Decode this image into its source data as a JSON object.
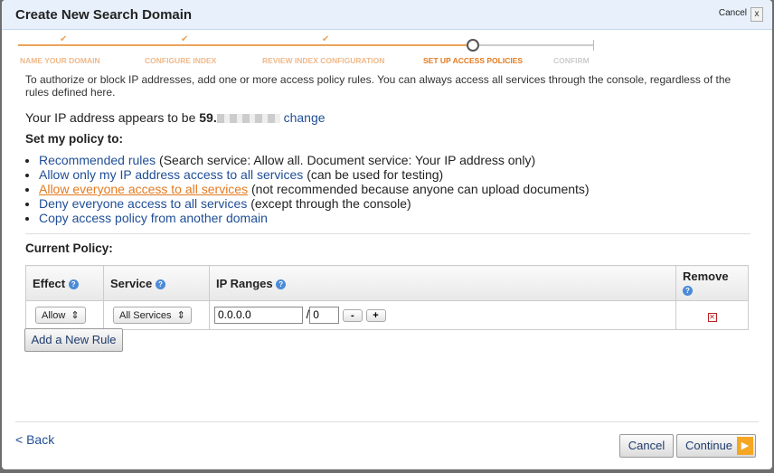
{
  "title": "Create New Search Domain",
  "cancel_top": "Cancel",
  "close": "x",
  "steps": [
    {
      "label": "NAME YOUR DOMAIN",
      "state": "done"
    },
    {
      "label": "CONFIGURE INDEX",
      "state": "done"
    },
    {
      "label": "REVIEW INDEX CONFIGURATION",
      "state": "done"
    },
    {
      "label": "SET UP ACCESS POLICIES",
      "state": "current"
    },
    {
      "label": "CONFIRM",
      "state": "pending"
    }
  ],
  "intro": "To authorize or block IP addresses, add one or more access policy rules. You can always access all services through the console, regardless of the rules defined here.",
  "ip_prefix": "Your IP address appears to be ",
  "ip_value": "59.",
  "ip_change": "change",
  "set_policy": "Set my policy to:",
  "options": [
    {
      "link": "Recommended rules",
      "rest": " (Search service: Allow all. Document service: Your IP address only)"
    },
    {
      "link": "Allow only my IP address access to all services",
      "rest": " (can be used for testing)"
    },
    {
      "link": "Allow everyone access to all services",
      "rest": " (not recommended because anyone can upload documents)"
    },
    {
      "link": "Deny everyone access to all services",
      "rest": " (except through the console)"
    },
    {
      "link": "Copy access policy from another domain",
      "rest": ""
    }
  ],
  "current_policy": "Current Policy:",
  "columns": [
    "Effect",
    "Service",
    "IP Ranges",
    "Remove"
  ],
  "rule": {
    "effect": "Allow",
    "service": "All Services",
    "ip": "0.0.0.0",
    "slash": "/",
    "mask": "0",
    "minus": "-",
    "plus": "+"
  },
  "add_rule": "Add a New Rule",
  "back": "< Back",
  "cancel": "Cancel",
  "continue": "Continue"
}
